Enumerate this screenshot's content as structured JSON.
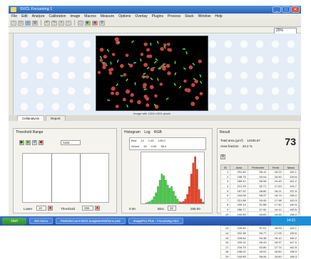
{
  "window": {
    "title": "SVCL Focussing 1",
    "min_label": "_",
    "max_label": "□",
    "close_label": "✕"
  },
  "menu": [
    "File",
    "Edit",
    "Analyze",
    "Calibration",
    "Image",
    "Macros",
    "Measure",
    "Options",
    "Overlay",
    "Plugins",
    "Process",
    "Stack",
    "Window",
    "Help"
  ],
  "toolbar": {
    "buttons": [
      {
        "icon": "new-icon",
        "glyph": "▫",
        "tone": ""
      },
      {
        "icon": "open-icon",
        "glyph": "▭",
        "tone": ""
      },
      {
        "icon": "save-icon",
        "glyph": "▪",
        "tone": "blue"
      },
      {
        "icon": "print-icon",
        "glyph": "▤",
        "tone": ""
      },
      {
        "icon": "undo-icon",
        "glyph": "↶",
        "tone": ""
      },
      {
        "icon": "redo-icon",
        "glyph": "↷",
        "tone": ""
      },
      {
        "icon": "zoom-in-icon",
        "glyph": "+",
        "tone": ""
      },
      {
        "icon": "zoom-out-icon",
        "glyph": "−",
        "tone": ""
      },
      {
        "icon": "select-icon",
        "glyph": "⬚",
        "tone": ""
      },
      {
        "icon": "run-icon",
        "glyph": "▶",
        "tone": "green"
      },
      {
        "icon": "stop-icon",
        "glyph": "■",
        "tone": "red"
      },
      {
        "icon": "settings-icon",
        "glyph": "⚙",
        "tone": ""
      }
    ]
  },
  "zoom_value": "25%",
  "image_caption": "Image with 1024×1024 pixels",
  "image_info": {
    "particle_count": 110
  },
  "colors": {
    "cells_red": "#c4453e",
    "cells_green": "#4bd44b",
    "hist_green": "#4fc24f",
    "hist_red": "#e0452a",
    "titlebar": "#2a62b5",
    "workspace": "#e4ecf6"
  },
  "tabs": [
    "Cellanalysis",
    "Report"
  ],
  "panels": {
    "threshold": {
      "title": "Threshold Range",
      "slider_label": "Auto",
      "lower_label": "Lower",
      "lower_value": "10",
      "upper_label": "Threshold",
      "upper_value": "255"
    },
    "histogram": {
      "title": "Histogram",
      "mode": "Log",
      "channel": "RGB",
      "rows": [
        {
          "label": "Red",
          "min": "12",
          "max": "1.00",
          "mean": "125.0"
        },
        {
          "label": "Green",
          "min": "15",
          "max": "0.94",
          "mean": "98.4"
        }
      ],
      "footer_left": "0.00",
      "footer_mid_label": "Bins",
      "footer_mid_value": "32",
      "footer_right": "255.00",
      "bins_green": [
        0,
        0,
        1,
        2,
        3,
        5,
        9,
        14,
        22,
        30,
        38,
        36,
        30,
        24,
        20,
        22,
        16,
        10,
        6,
        3,
        2,
        1,
        0,
        0,
        0,
        0,
        0,
        0,
        0,
        0,
        0,
        0
      ],
      "bins_red": [
        0,
        0,
        0,
        0,
        0,
        0,
        0,
        0,
        0,
        0,
        0,
        0,
        0,
        0,
        0,
        0,
        0,
        0,
        0,
        1,
        2,
        3,
        6,
        12,
        22,
        38,
        52,
        60,
        44,
        18,
        6,
        2
      ]
    },
    "results": {
      "title": "Result",
      "big_value": "73",
      "label1": "Total area (µm²)",
      "value1": "12345.67",
      "label2": "Area fraction",
      "value2": "43.2 %",
      "table_header": [
        "ID",
        "Area",
        "Perimeter",
        "Feret",
        "Mean"
      ],
      "table_rows": [
        [
          "1",
          "231.40",
          "55.12",
          "18.22",
          "142.1"
        ],
        [
          "2",
          "198.75",
          "50.04",
          "16.90",
          "139.8"
        ],
        [
          "3",
          "265.10",
          "58.96",
          "19.45",
          "151.2"
        ],
        [
          "4",
          "212.33",
          "52.71",
          "17.63",
          "144.7"
        ],
        [
          "5",
          "187.92",
          "48.80",
          "16.21",
          "137.5"
        ],
        [
          "6",
          "244.06",
          "56.37",
          "18.74",
          "148.0"
        ],
        [
          "7",
          "221.58",
          "53.49",
          "17.98",
          "143.3"
        ],
        [
          "8",
          "209.14",
          "51.88",
          "17.40",
          "140.9"
        ],
        [
          "9",
          "256.77",
          "57.92",
          "19.12",
          "150.6"
        ],
        [
          "10",
          "193.45",
          "49.63",
          "16.55",
          "138.2"
        ],
        [
          "11",
          "238.21",
          "55.80",
          "18.50",
          "146.4"
        ],
        [
          "12",
          "217.09",
          "52.95",
          "17.81",
          "142.8"
        ],
        [
          "13",
          "249.60",
          "57.01",
          "18.93",
          "149.1"
        ],
        [
          "14",
          "202.38",
          "50.77",
          "17.05",
          "139.6"
        ],
        [
          "15",
          "228.84",
          "54.36",
          "18.10",
          "145.2"
        ],
        [
          "16",
          "235.11",
          "55.43",
          "18.37",
          "147.0"
        ],
        [
          "17",
          "216.70",
          "52.80",
          "17.74",
          "142.5"
        ],
        [
          "18",
          "198.02",
          "49.91",
          "16.80",
          "138.9"
        ],
        [
          "19",
          "244.85",
          "56.44",
          "18.80",
          "148.3"
        ]
      ]
    }
  },
  "taskbar": {
    "start": "start",
    "items": [
      "SIS Docu",
      "ParticleCount MCD ausgewertet/3cnc.psd",
      "ImagePro Plus - Focussing AD1"
    ],
    "clock": "14:21"
  }
}
